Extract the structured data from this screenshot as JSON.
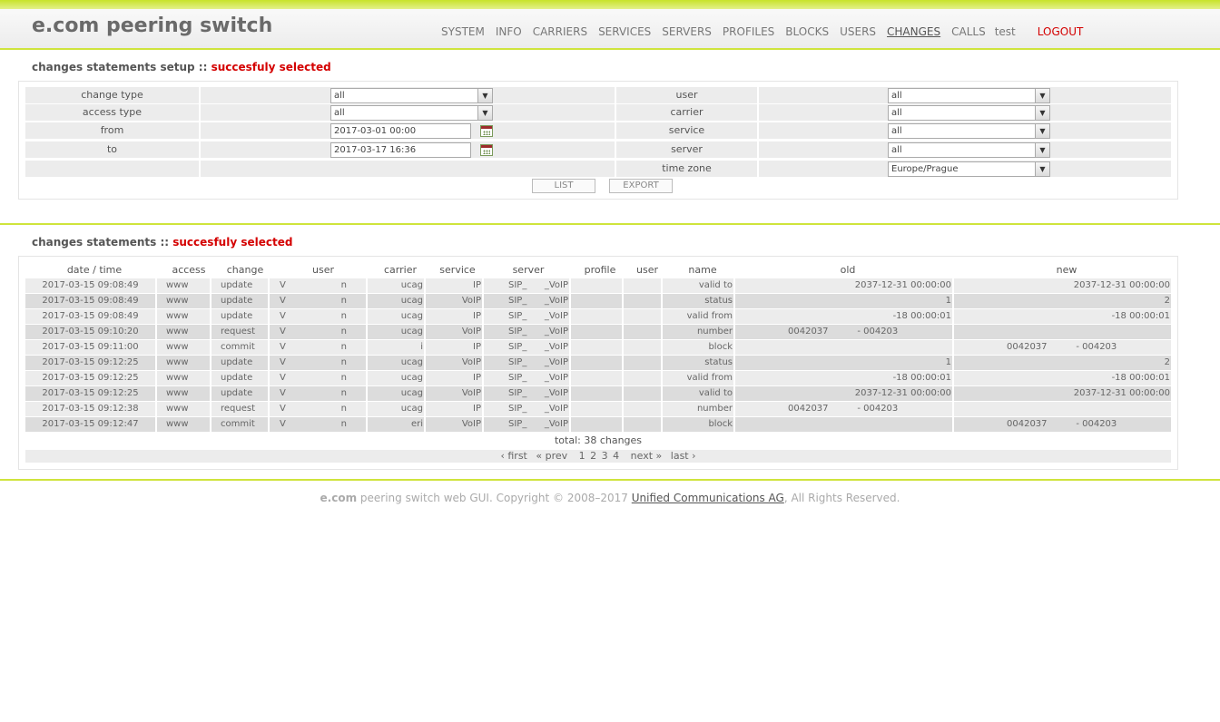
{
  "header": {
    "brand": "e.com peering switch",
    "nav": [
      "SYSTEM",
      "INFO",
      "CARRIERS",
      "SERVICES",
      "SERVERS",
      "PROFILES",
      "BLOCKS",
      "USERS",
      "CHANGES",
      "CALLS"
    ],
    "active": "CHANGES",
    "username": "test",
    "logout": "LOGOUT"
  },
  "setup": {
    "title": "changes statements setup",
    "sep": "::",
    "status": "succesfuly selected",
    "fields": {
      "change_type": {
        "label": "change type",
        "value": "all"
      },
      "access_type": {
        "label": "access type",
        "value": "all"
      },
      "from": {
        "label": "from",
        "value": "2017-03-01 00:00"
      },
      "to": {
        "label": "to",
        "value": "2017-03-17 16:36"
      },
      "user": {
        "label": "user",
        "value": "all"
      },
      "carrier": {
        "label": "carrier",
        "value": "all"
      },
      "service": {
        "label": "service",
        "value": "all"
      },
      "server": {
        "label": "server",
        "value": "all"
      },
      "time_zone": {
        "label": "time zone",
        "value": "Europe/Prague"
      }
    },
    "buttons": {
      "list": "LIST",
      "export": "EXPORT"
    }
  },
  "results": {
    "title": "changes statements",
    "sep": "::",
    "status": "succesfuly selected",
    "columns": [
      "date / time",
      "access",
      "change",
      "user",
      "carrier",
      "service",
      "server",
      "profile",
      "user",
      "name",
      "old",
      "new"
    ],
    "rows": [
      [
        "2017-03-15 09:08:49",
        "www",
        "update",
        "V",
        "n",
        "ucag",
        "IP",
        "SIP_",
        "_VoIP",
        "",
        "",
        "valid to",
        "2037-12-31 00:00:00",
        "2037-12-31 00:00:00"
      ],
      [
        "2017-03-15 09:08:49",
        "www",
        "update",
        "V",
        "n",
        "ucag",
        "VoIP",
        "SIP_",
        "_VoIP",
        "",
        "",
        "status",
        "1",
        "2"
      ],
      [
        "2017-03-15 09:08:49",
        "www",
        "update",
        "V",
        "n",
        "ucag",
        "IP",
        "SIP_",
        "_VoIP",
        "",
        "",
        "valid from",
        "-18 00:00:01",
        "-18 00:00:01"
      ],
      [
        "2017-03-15 09:10:20",
        "www",
        "request",
        "V",
        "n",
        "ucag",
        "VoIP",
        "SIP_",
        "_VoIP",
        "",
        "",
        "number",
        "0042037          - 004203",
        ""
      ],
      [
        "2017-03-15 09:11:00",
        "www",
        "commit",
        "V",
        "n",
        "i",
        "IP",
        "SIP_",
        "_VoIP",
        "",
        "",
        "block",
        "",
        "0042037          - 004203"
      ],
      [
        "2017-03-15 09:12:25",
        "www",
        "update",
        "V",
        "n",
        "ucag",
        "VoIP",
        "SIP_",
        "_VoIP",
        "",
        "",
        "status",
        "1",
        "2"
      ],
      [
        "2017-03-15 09:12:25",
        "www",
        "update",
        "V",
        "n",
        "ucag",
        "IP",
        "SIP_",
        "_VoIP",
        "",
        "",
        "valid from",
        "-18 00:00:01",
        "-18 00:00:01"
      ],
      [
        "2017-03-15 09:12:25",
        "www",
        "update",
        "V",
        "n",
        "ucag",
        "VoIP",
        "SIP_",
        "_VoIP",
        "",
        "",
        "valid to",
        "2037-12-31 00:00:00",
        "2037-12-31 00:00:00"
      ],
      [
        "2017-03-15 09:12:38",
        "www",
        "request",
        "V",
        "n",
        "ucag",
        "IP",
        "SIP_",
        "_VoIP",
        "",
        "",
        "number",
        "0042037          - 004203",
        ""
      ],
      [
        "2017-03-15 09:12:47",
        "www",
        "commit",
        "V",
        "n",
        "eri",
        "VoIP",
        "SIP_",
        "_VoIP",
        "",
        "",
        "block",
        "",
        "0042037          - 004203"
      ]
    ],
    "total": "total: 38 changes",
    "pager": {
      "first": "‹ first",
      "prev": "« prev",
      "pages": [
        "1",
        "2",
        "3",
        "4"
      ],
      "next": "next »",
      "last": "last ›"
    }
  },
  "footer": {
    "brand": "e.com",
    "text": " peering switch web GUI. Copyright © 2008–2017 ",
    "company": "Unified Communications AG",
    "rights": ", All Rights Reserved."
  }
}
